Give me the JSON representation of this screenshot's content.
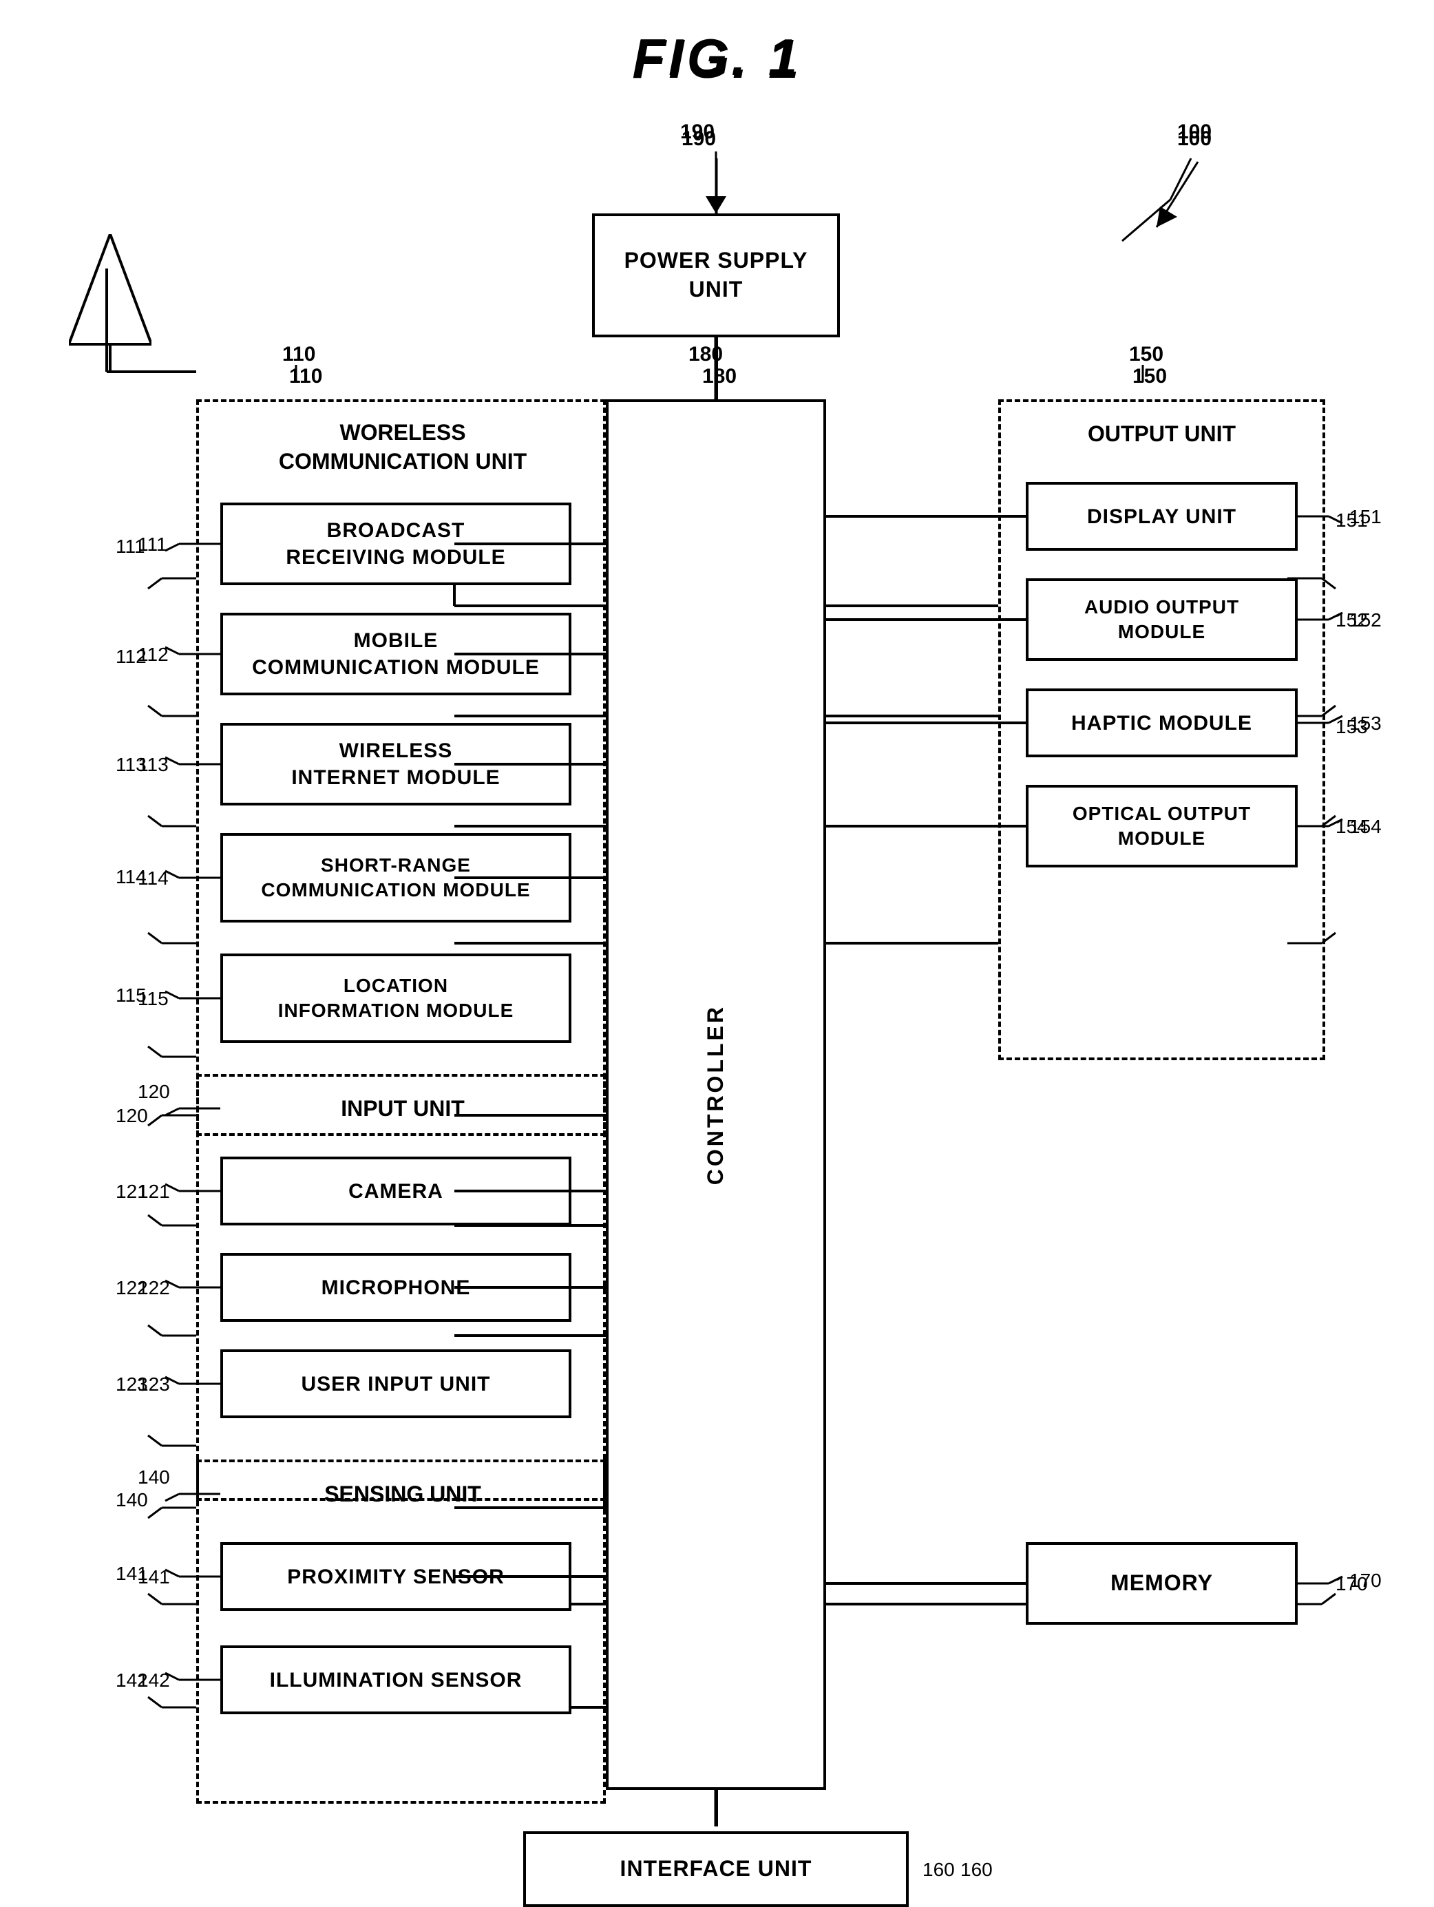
{
  "title": "FIG. 1",
  "refs": {
    "r100": "100",
    "r110": "110",
    "r111": "111",
    "r112": "112",
    "r113": "113",
    "r114": "114",
    "r115": "115",
    "r120": "120",
    "r121": "121",
    "r122": "122",
    "r123": "123",
    "r140": "140",
    "r141": "141",
    "r142": "142",
    "r150": "150",
    "r151": "151",
    "r152": "152",
    "r153": "153",
    "r154": "154",
    "r160": "160",
    "r170": "170",
    "r180": "180",
    "r190": "190"
  },
  "boxes": {
    "power_supply": "POWER SUPPLY\nUNIT",
    "controller": "CONTROLLER",
    "interface_unit": "INTERFACE UNIT",
    "memory": "MEMORY",
    "wireless_comm": "WORELESS\nCOMMUNICATION UNIT",
    "broadcast": "BROADCAST\nRECEIVING MODULE",
    "mobile_comm": "MOBILE\nCOMMUNICATION MODULE",
    "wireless_internet": "WIRELESS\nINTERNET MODULE",
    "short_range": "SHORT-RANGE\nCOMMUNICATION MODULE",
    "location_info": "LOCATION\nINFORMATION MODULE",
    "input_unit": "INPUT UNIT",
    "camera": "CAMERA",
    "microphone": "MICROPHONE",
    "user_input": "USER INPUT UNIT",
    "sensing_unit": "SENSING UNIT",
    "proximity": "PROXIMITY SENSOR",
    "illumination": "ILLUMINATION SENSOR",
    "output_unit": "OUTPUT UNIT",
    "display_unit": "DISPLAY UNIT",
    "audio_output": "AUDIO OUTPUT\nMODULE",
    "haptic_module": "HAPTIC MODULE",
    "optical_output": "OPTICAL OUTPUT\nMODULE"
  }
}
